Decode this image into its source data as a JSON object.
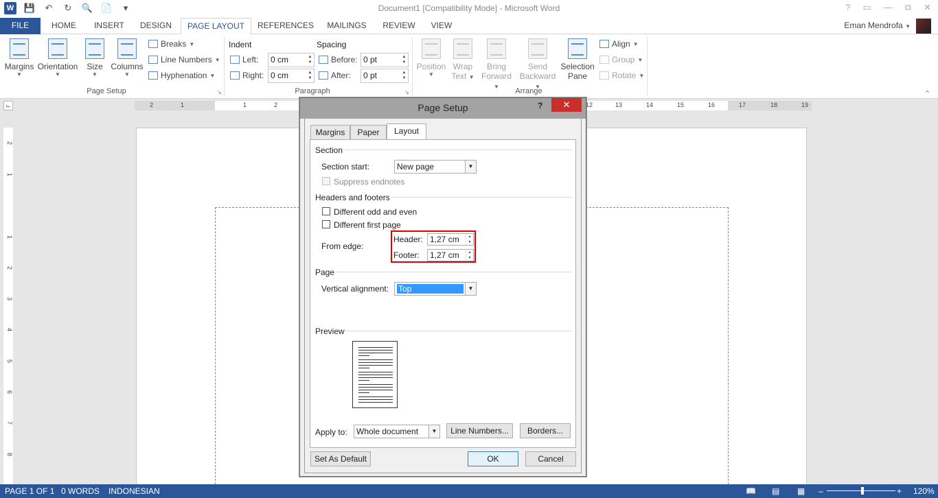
{
  "window": {
    "title": "Document1 [Compatibility Mode] - Microsoft Word",
    "help": "?",
    "user_name": "Eman Mendrofa"
  },
  "tabs": [
    "FILE",
    "HOME",
    "INSERT",
    "DESIGN",
    "PAGE LAYOUT",
    "REFERENCES",
    "MAILINGS",
    "REVIEW",
    "VIEW"
  ],
  "active_tab": "PAGE LAYOUT",
  "ribbon": {
    "page_setup": {
      "margins": "Margins",
      "orientation": "Orientation",
      "size": "Size",
      "columns": "Columns",
      "breaks": "Breaks",
      "line_numbers": "Line Numbers",
      "hyphenation": "Hyphenation",
      "group_label": "Page Setup"
    },
    "paragraph": {
      "indent_label": "Indent",
      "spacing_label": "Spacing",
      "left_label": "Left:",
      "left_value": "0 cm",
      "right_label": "Right:",
      "right_value": "0 cm",
      "before_label": "Before:",
      "before_value": "0 pt",
      "after_label": "After:",
      "after_value": "0 pt",
      "group_label": "Paragraph"
    },
    "arrange": {
      "position_1": "Position",
      "wrap_1": "Wrap",
      "wrap_2": "Text",
      "bring_1": "Bring",
      "bring_2": "Forward",
      "send_1": "Send",
      "send_2": "Backward",
      "selection_1": "Selection",
      "selection_2": "Pane",
      "align": "Align",
      "group": "Group",
      "rotate": "Rotate",
      "group_label": "Arrange"
    }
  },
  "ruler": {
    "h_numbers": [
      "2",
      "1",
      "1",
      "2",
      "12",
      "13",
      "14",
      "15",
      "16",
      "17",
      "18",
      "19"
    ],
    "v_numbers": [
      "2",
      "1",
      "1",
      "2",
      "3",
      "4",
      "5",
      "6",
      "7",
      "8"
    ]
  },
  "dialog": {
    "title": "Page Setup",
    "help": "?",
    "close": "✕",
    "tabs": [
      "Margins",
      "Paper",
      "Layout"
    ],
    "active_tab": "Layout",
    "section": {
      "heading": "Section",
      "start_label": "Section start:",
      "start_value": "New page",
      "suppress_endnotes": "Suppress endnotes"
    },
    "headers_footers": {
      "heading": "Headers and footers",
      "odd_even": "Different odd and even",
      "first_page": "Different first page",
      "from_edge": "From edge:",
      "header_label": "Header:",
      "header_value": "1,27 cm",
      "footer_label": "Footer:",
      "footer_value": "1,27 cm"
    },
    "page": {
      "heading": "Page",
      "vertical_alignment_label": "Vertical alignment:",
      "vertical_alignment_value": "Top"
    },
    "preview": {
      "heading": "Preview"
    },
    "apply": {
      "label": "Apply to:",
      "value": "Whole document",
      "line_numbers_button": "Line Numbers...",
      "borders_button": "Borders..."
    },
    "buttons": {
      "set_default": "Set As Default",
      "ok": "OK",
      "cancel": "Cancel"
    }
  },
  "status": {
    "page": "PAGE 1 OF 1",
    "words": "0 WORDS",
    "language": "INDONESIAN",
    "zoom": "120%"
  }
}
